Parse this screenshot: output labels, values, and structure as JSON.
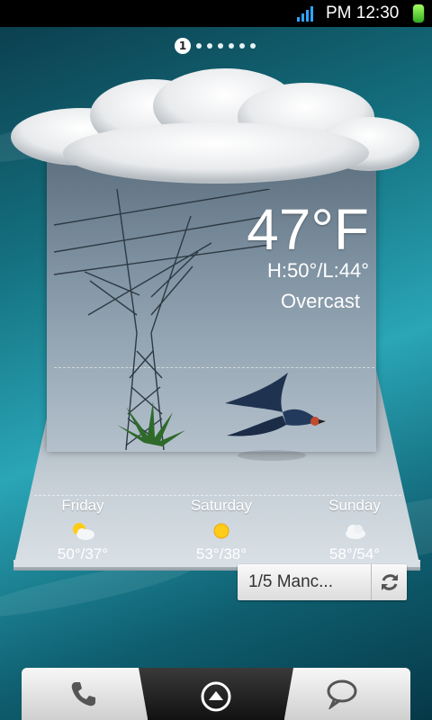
{
  "status_bar": {
    "time": "PM 12:30",
    "icons": [
      "signal-icon",
      "battery-icon"
    ],
    "signal_color": "#2fa4ff",
    "battery_color": "#4fd12c"
  },
  "page_indicator": {
    "current": "1",
    "total_dots": 7
  },
  "weather": {
    "temperature": "47°F",
    "high_low": "H:50°/L:44°",
    "condition": "Overcast"
  },
  "forecast": [
    {
      "day": "Friday",
      "icon": "partly-sunny-icon",
      "temps": "50°/37°"
    },
    {
      "day": "Saturday",
      "icon": "sunny-icon",
      "temps": "53°/38°"
    },
    {
      "day": "Sunday",
      "icon": "cloudy-icon",
      "temps": "58°/54°"
    }
  ],
  "location": {
    "label": "1/5 Manc..."
  },
  "dock": {
    "icons": [
      "phone-icon",
      "app-drawer-icon",
      "messages-icon"
    ]
  }
}
